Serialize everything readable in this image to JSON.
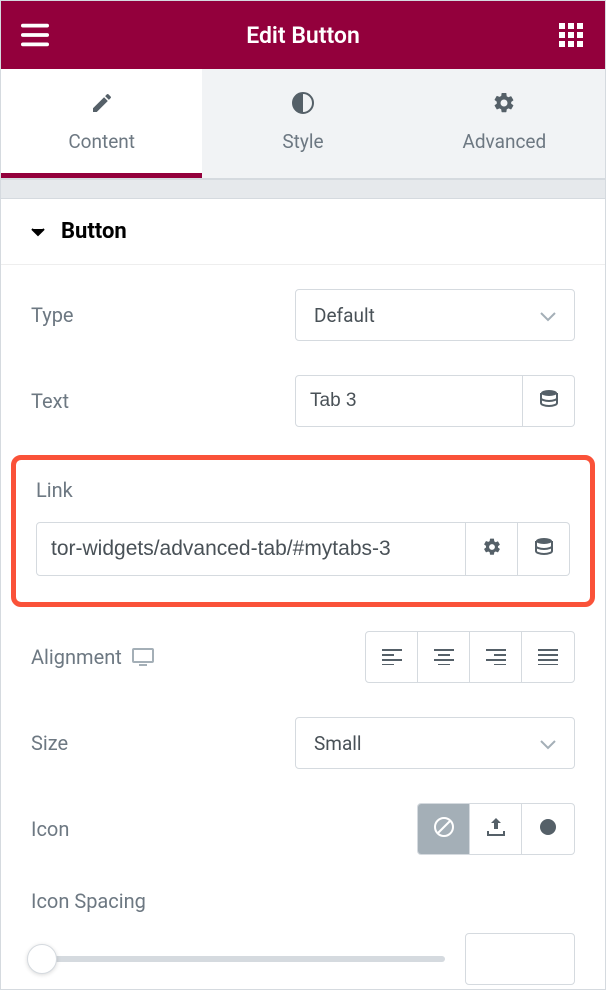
{
  "header": {
    "title": "Edit Button"
  },
  "tabs": {
    "content": "Content",
    "style": "Style",
    "advanced": "Advanced"
  },
  "section": {
    "title": "Button"
  },
  "controls": {
    "type": {
      "label": "Type",
      "value": "Default"
    },
    "text": {
      "label": "Text",
      "value": "Tab 3"
    },
    "link": {
      "label": "Link",
      "value": "tor-widgets/advanced-tab/#mytabs-3"
    },
    "alignment": {
      "label": "Alignment"
    },
    "size": {
      "label": "Size",
      "value": "Small"
    },
    "icon": {
      "label": "Icon"
    },
    "iconSpacing": {
      "label": "Icon Spacing",
      "value": ""
    }
  },
  "colors": {
    "brand": "#93003c",
    "highlight": "#fa5239"
  }
}
